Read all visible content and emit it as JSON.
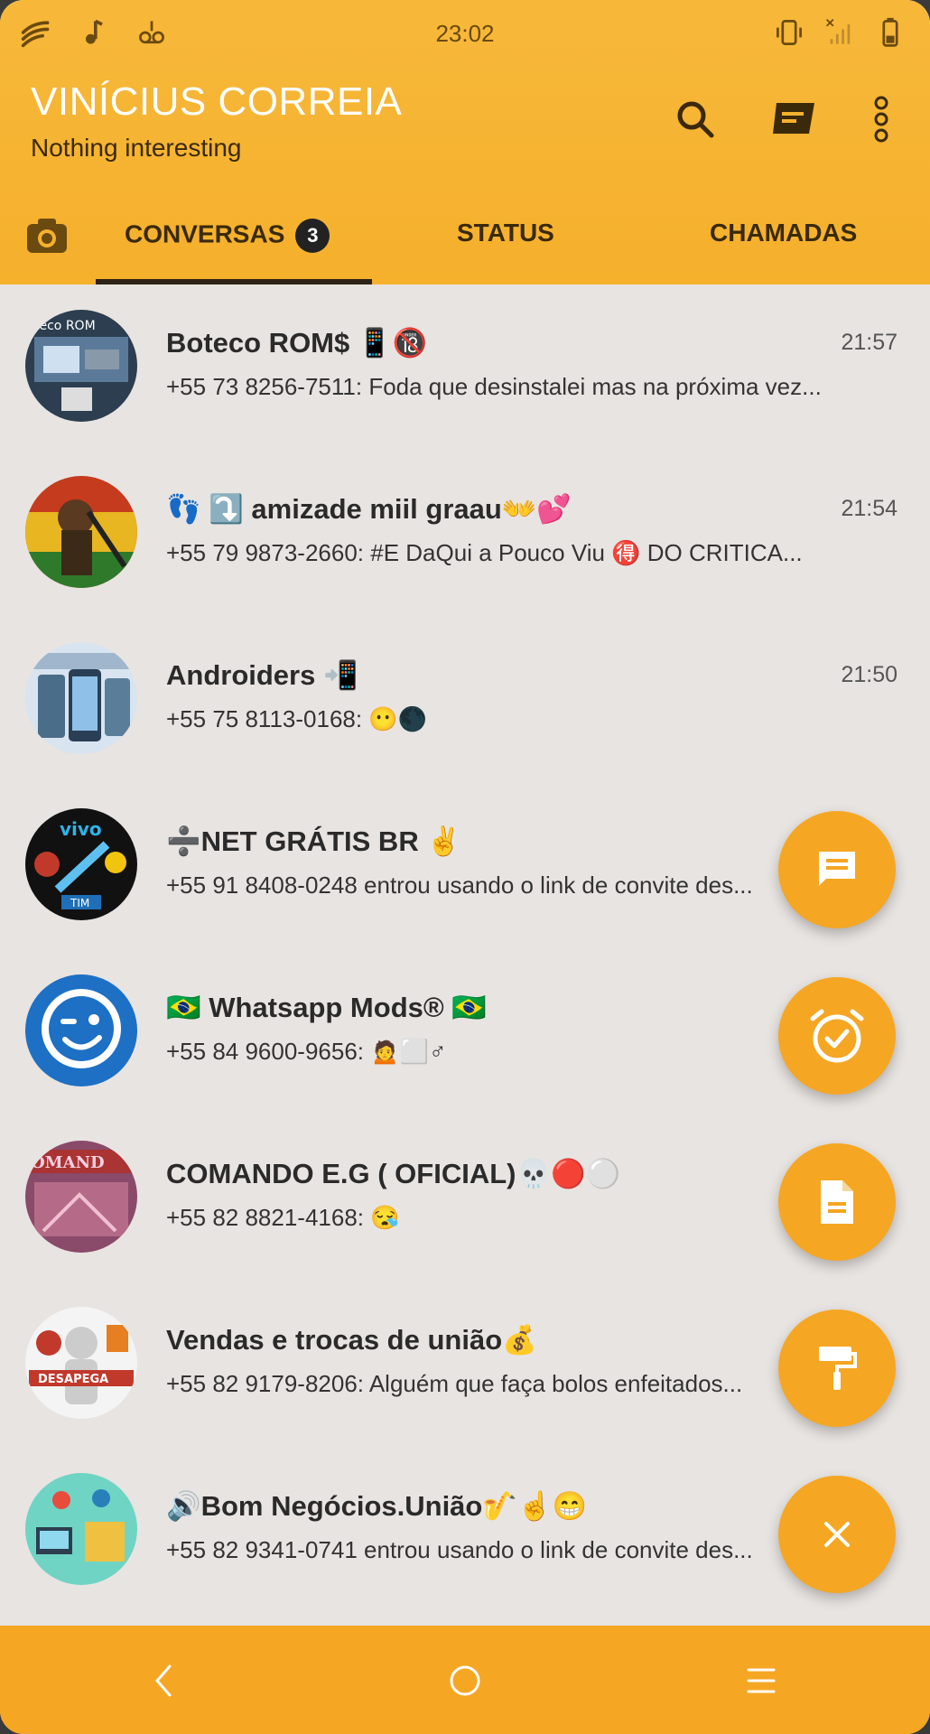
{
  "status_bar": {
    "time": "23:02"
  },
  "header": {
    "title": "VINÍCIUS CORREIA",
    "subtitle": "Nothing interesting",
    "icons": [
      "search-icon",
      "new-message-icon",
      "more-vert-icon"
    ]
  },
  "tabs": {
    "camera_icon": "camera-icon",
    "conversas": "CONVERSAS",
    "conversas_badge": "3",
    "status": "STATUS",
    "chamadas": "CHAMADAS"
  },
  "chats": [
    {
      "name": "Boteco ROM$ 📱🔞",
      "time": "21:57",
      "message": "+55 73 8256-7511: Foda que desinstalei mas na próxima vez..."
    },
    {
      "name": "👣 ⤵️ amizade miil graau👐💕",
      "time": "21:54",
      "message": "+55 79 9873-2660: #E DaQui a Pouco Viu     🉐 DO CRITICA..."
    },
    {
      "name": "Androiders 📲",
      "time": "21:50",
      "message": "+55 75 8113-0168: 😶🌑"
    },
    {
      "name": "➗NET GRÁTIS BR ✌️",
      "time": "",
      "message": "+55 91 8408-0248 entrou usando o link de convite des..."
    },
    {
      "name": "🇧🇷 Whatsapp Mods® 🇧🇷",
      "time": "",
      "message": "+55 84 9600-9656: 🙍⬜♂"
    },
    {
      "name": "COMANDO E.G ( OFICIAL)💀🔴⚪",
      "time": "",
      "message": "+55 82 8821-4168: 😪"
    },
    {
      "name": "Vendas e trocas de união💰",
      "time": "",
      "message": "+55 82 9179-8206: Alguém que faça bolos enfeitados..."
    },
    {
      "name": "🔊Bom Negócios.União🎷☝️😁",
      "time": "",
      "message": "+55 82 9341-0741 entrou usando o link de convite des..."
    }
  ],
  "fabs": [
    "message-icon",
    "alarm-check-icon",
    "document-icon",
    "paint-roller-icon",
    "close-icon"
  ],
  "colors": {
    "accent": "#f5a623",
    "header": "#f7b83a",
    "background": "#e8e4e1"
  }
}
